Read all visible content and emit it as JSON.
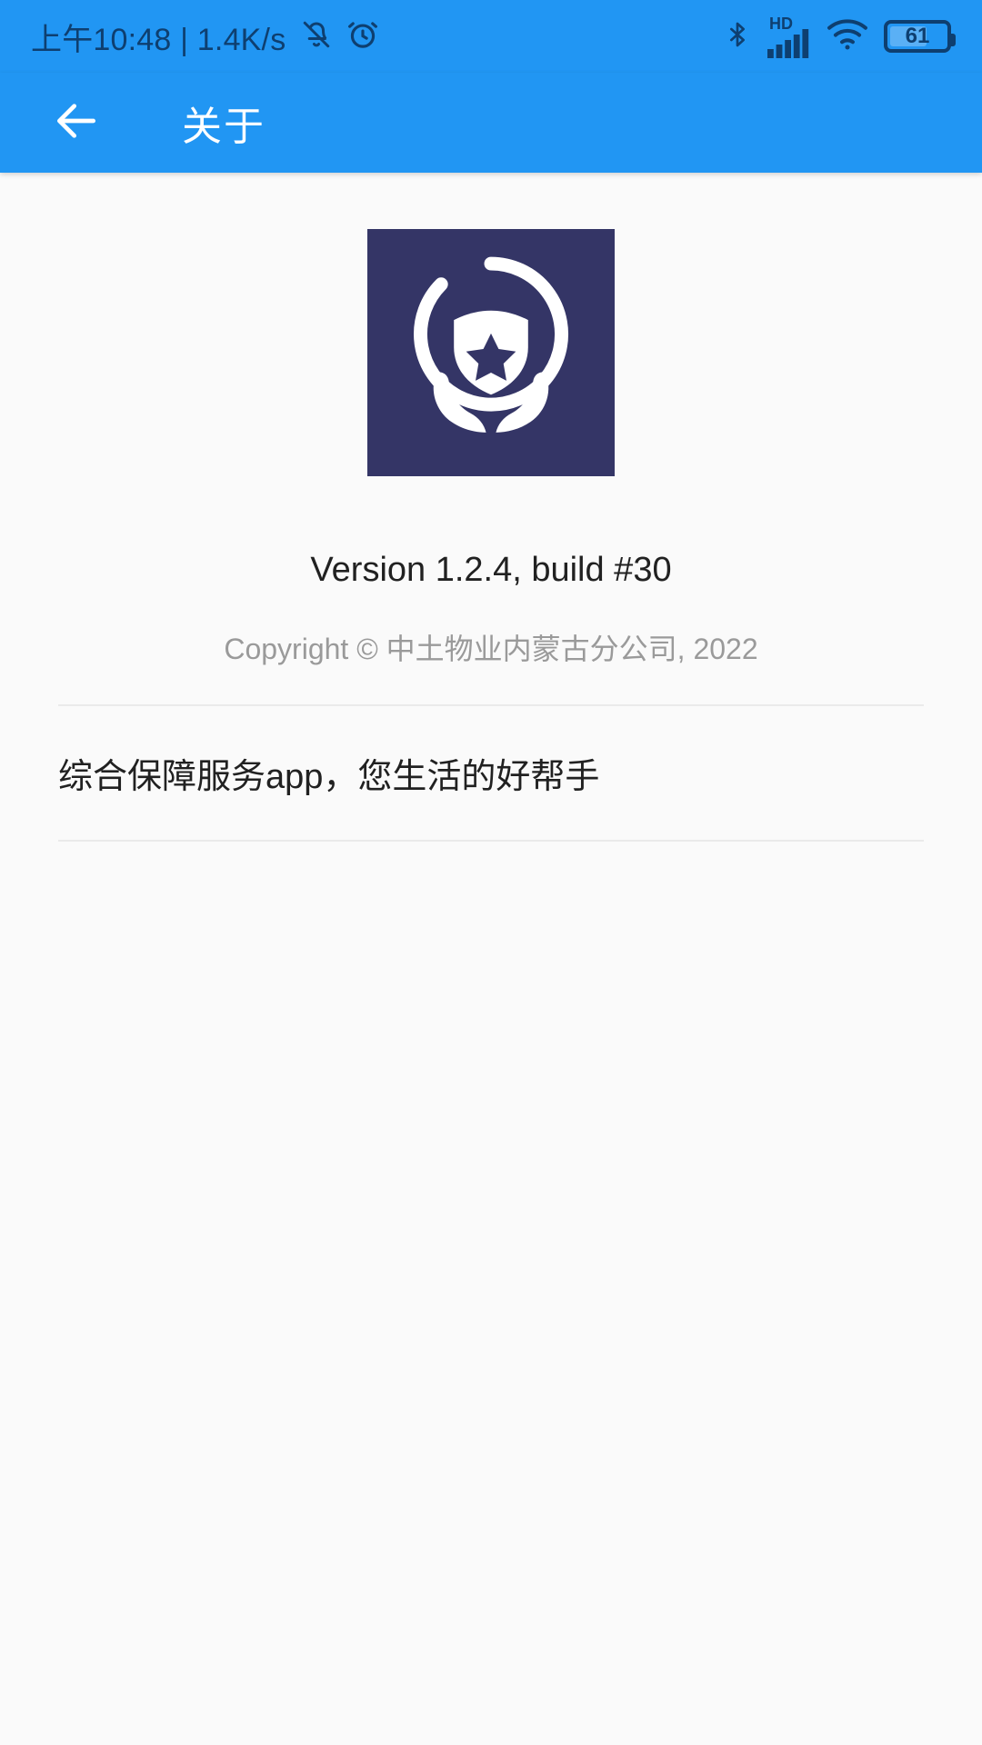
{
  "status_bar": {
    "clock": "上午10:48 | 1.4K/s",
    "icons_left": [
      "bell-muted-icon",
      "alarm-clock-icon"
    ],
    "icons_right": [
      "bluetooth-icon",
      "hd-signal-icon",
      "wifi-icon",
      "battery-icon"
    ],
    "hd_label": "HD",
    "battery_level": "61",
    "background_color": "#2196f3",
    "foreground_color": "#0e3f70"
  },
  "app_bar": {
    "back_icon": "arrow-left-icon",
    "title": "关于",
    "background_color": "#2196f3",
    "title_color": "#ffffff"
  },
  "main": {
    "logo": {
      "icon_name": "app-logo-shield-hands-icon",
      "background_color": "#343566",
      "mark_color": "#ffffff"
    },
    "version": "Version 1.2.4, build #30",
    "copyright": "Copyright © 中土物业内蒙古分公司, 2022",
    "tagline": "综合保障服务app，您生活的好帮手"
  }
}
